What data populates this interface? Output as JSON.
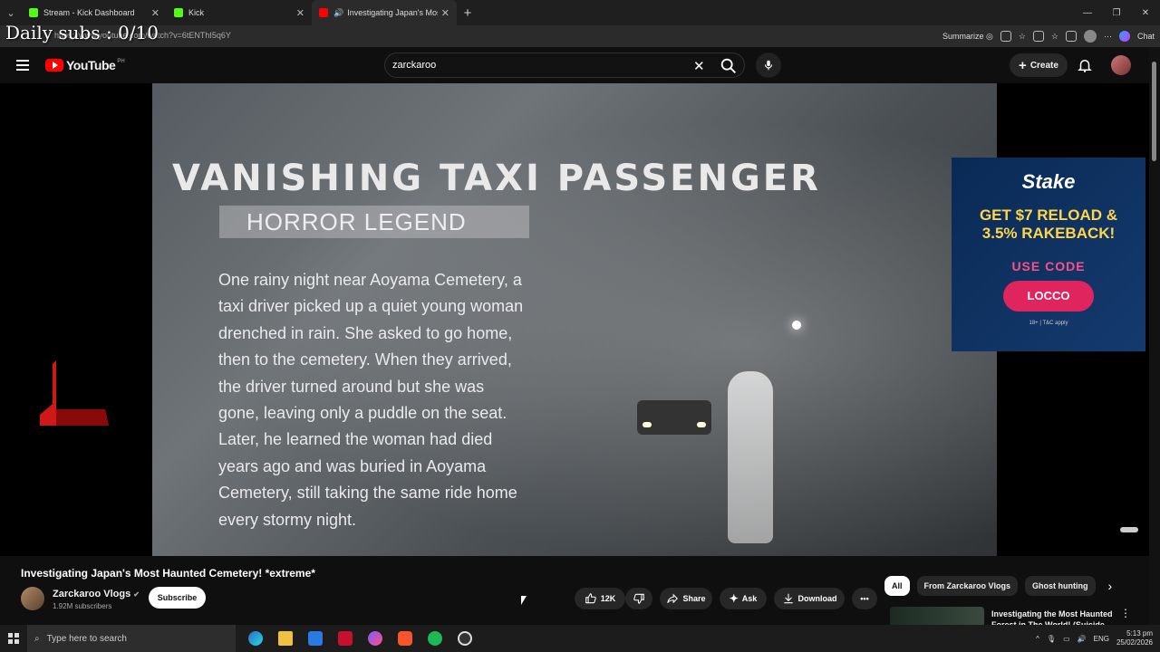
{
  "browser": {
    "tabs": [
      {
        "title": "Stream - Kick Dashboard",
        "color": "#53fc18"
      },
      {
        "title": "Kick",
        "color": "#53fc18"
      },
      {
        "title": "Investigating Japan's Most Ha",
        "color": "#ff0000"
      }
    ],
    "url": "https://www.youtube.com/watch?v=6tENThI5q6Y",
    "summarize_label": "Summarize",
    "chat_label": "Chat"
  },
  "overlay": {
    "text": "Daily subs : 0/10"
  },
  "youtube": {
    "logo_text": "YouTube",
    "country": "PH",
    "search_value": "zarckaroo",
    "create_label": "Create"
  },
  "video_frame": {
    "title": "VANISHING TAXI PASSENGER",
    "subtitle": "HORROR LEGEND",
    "body": "One rainy night near Aoyama Cemetery, a\ntaxi driver picked up a quiet young woman\ndrenched in rain. She asked to go home,\nthen to the cemetery. When they arrived,\nthe driver turned around but she was\ngone, leaving only a puddle on the seat.\nLater, he learned the woman had died\nyears ago and was buried in Aoyama\nCemetery, still taking the same ride home\nevery stormy night."
  },
  "ad": {
    "brand": "Stake",
    "headline_1": "GET $7 RELOAD &",
    "headline_2": "3.5% RAKEBACK!",
    "code_label": "USE CODE",
    "code": "LOCCO",
    "terms": "18+ | T&C apply"
  },
  "video_info": {
    "title": "Investigating Japan's Most Haunted Cemetery! *extreme*",
    "channel": "Zarckaroo Vlogs",
    "subscribers": "1.92M subscribers",
    "subscribe_label": "Subscribe",
    "likes": "12K",
    "share_label": "Share",
    "ask_label": "Ask",
    "download_label": "Download"
  },
  "chips": [
    "All",
    "From Zarckaroo Vlogs",
    "Ghost hunting"
  ],
  "recommendation": {
    "title": "Investigating the Most Haunted Forest in The World! (Suicide"
  },
  "taskbar": {
    "search_placeholder": "Type here to search",
    "language": "ENG",
    "time": "5:13 pm",
    "date": "25/02/2026"
  }
}
